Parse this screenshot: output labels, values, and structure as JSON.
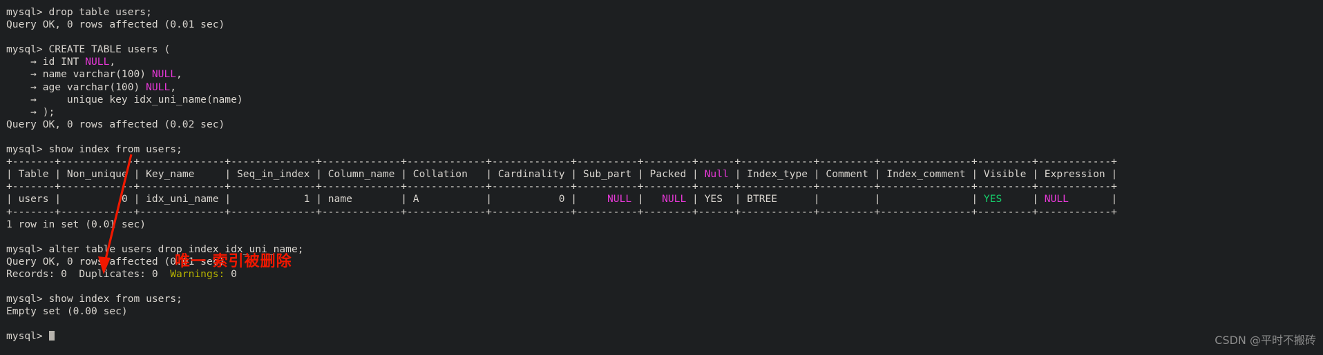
{
  "terminal": {
    "prompt": "mysql> ",
    "continuation": "    → ",
    "colors": {
      "background": "#1d1f21",
      "foreground": "#d9d5cf",
      "null_magenta": "#e838d8",
      "yes_green": "#15cf6b",
      "warnings_yellow": "#b5b100",
      "annotation_red": "#f01800",
      "watermark_gray": "#8c8c8c"
    },
    "lines": [
      {
        "id": "l01",
        "text": "mysql> drop table users;"
      },
      {
        "id": "l02",
        "text": "Query OK, 0 rows affected (0.01 sec)"
      },
      {
        "id": "l03",
        "text": ""
      },
      {
        "id": "l04",
        "text": "mysql> CREATE TABLE users ("
      },
      {
        "id": "l05",
        "text": "    → id INT ",
        "tail": "NULL",
        "tail_class": "null",
        "tail2": ","
      },
      {
        "id": "l06",
        "text": "    → name varchar(100) ",
        "tail": "NULL",
        "tail_class": "null",
        "tail2": ","
      },
      {
        "id": "l07",
        "text": "    → age varchar(100) ",
        "tail": "NULL",
        "tail_class": "null",
        "tail2": ","
      },
      {
        "id": "l08",
        "text": "    →     unique key idx_uni_name(name)"
      },
      {
        "id": "l09",
        "text": "    → );"
      },
      {
        "id": "l10",
        "text": "Query OK, 0 rows affected (0.02 sec)"
      },
      {
        "id": "l11",
        "text": ""
      },
      {
        "id": "l12",
        "text": "mysql> show index from users;"
      }
    ],
    "result_table": {
      "separator": "+-------+------------+--------------+--------------+-------------+-------------+-------------+----------+--------+------+------------+---------+---------------+---------+------------+",
      "header_cells": [
        {
          "label": "Table",
          "width": 5,
          "align": "left",
          "color": "default"
        },
        {
          "label": "Non_unique",
          "width": 10,
          "align": "left",
          "color": "default"
        },
        {
          "label": "Key_name",
          "width": 12,
          "align": "left",
          "color": "default"
        },
        {
          "label": "Seq_in_index",
          "width": 12,
          "align": "left",
          "color": "default"
        },
        {
          "label": "Column_name",
          "width": 11,
          "align": "left",
          "color": "default"
        },
        {
          "label": "Collation",
          "width": 11,
          "align": "left",
          "color": "default"
        },
        {
          "label": "Cardinality",
          "width": 11,
          "align": "left",
          "color": "default"
        },
        {
          "label": "Sub_part",
          "width": 8,
          "align": "left",
          "color": "default"
        },
        {
          "label": "Packed",
          "width": 6,
          "align": "left",
          "color": "default"
        },
        {
          "label": "Null",
          "width": 4,
          "align": "left",
          "color": "null"
        },
        {
          "label": "Index_type",
          "width": 10,
          "align": "left",
          "color": "default"
        },
        {
          "label": "Comment",
          "width": 7,
          "align": "left",
          "color": "default"
        },
        {
          "label": "Index_comment",
          "width": 13,
          "align": "left",
          "color": "default"
        },
        {
          "label": "Visible",
          "width": 7,
          "align": "left",
          "color": "default"
        },
        {
          "label": "Expression",
          "width": 10,
          "align": "left",
          "color": "default"
        }
      ],
      "rows": [
        [
          {
            "value": "users",
            "width": 5,
            "align": "left",
            "color": "default"
          },
          {
            "value": "0",
            "width": 10,
            "align": "right",
            "color": "default"
          },
          {
            "value": "idx_uni_name",
            "width": 12,
            "align": "left",
            "color": "default"
          },
          {
            "value": "1",
            "width": 12,
            "align": "right",
            "color": "default"
          },
          {
            "value": "name",
            "width": 11,
            "align": "left",
            "color": "default"
          },
          {
            "value": "A",
            "width": 11,
            "align": "left",
            "color": "default"
          },
          {
            "value": "0",
            "width": 11,
            "align": "right",
            "color": "default"
          },
          {
            "value": "NULL",
            "width": 8,
            "align": "right",
            "color": "null"
          },
          {
            "value": "NULL",
            "width": 6,
            "align": "right",
            "color": "null"
          },
          {
            "value": "YES",
            "width": 4,
            "align": "left",
            "color": "default"
          },
          {
            "value": "BTREE",
            "width": 10,
            "align": "left",
            "color": "default"
          },
          {
            "value": "",
            "width": 7,
            "align": "left",
            "color": "default"
          },
          {
            "value": "",
            "width": 13,
            "align": "left",
            "color": "default"
          },
          {
            "value": "YES",
            "width": 7,
            "align": "left",
            "color": "green"
          },
          {
            "value": "NULL",
            "width": 10,
            "align": "left",
            "color": "null"
          }
        ]
      ]
    },
    "lines_after": [
      {
        "id": "l20",
        "text": "1 row in set (0.01 sec)"
      },
      {
        "id": "l21",
        "text": ""
      },
      {
        "id": "l22",
        "text": "mysql> alter table users drop index idx_uni_name;"
      },
      {
        "id": "l23",
        "text": "Query OK, 0 rows affected (0.01 sec)"
      },
      {
        "id": "l24",
        "text": "Records: 0  Duplicates: 0  ",
        "tail": "Warnings:",
        "tail_class": "yellow",
        "tail2": " 0"
      },
      {
        "id": "l25",
        "text": ""
      },
      {
        "id": "l26",
        "text": "mysql> show index from users;"
      },
      {
        "id": "l27",
        "text": "Empty set (0.00 sec)"
      },
      {
        "id": "l28",
        "text": ""
      }
    ],
    "final_prompt": "mysql> "
  },
  "annotation": {
    "text": "唯一 索引被删除",
    "color": "#f01800"
  },
  "watermark": {
    "text": "CSDN @平时不搬砖"
  }
}
